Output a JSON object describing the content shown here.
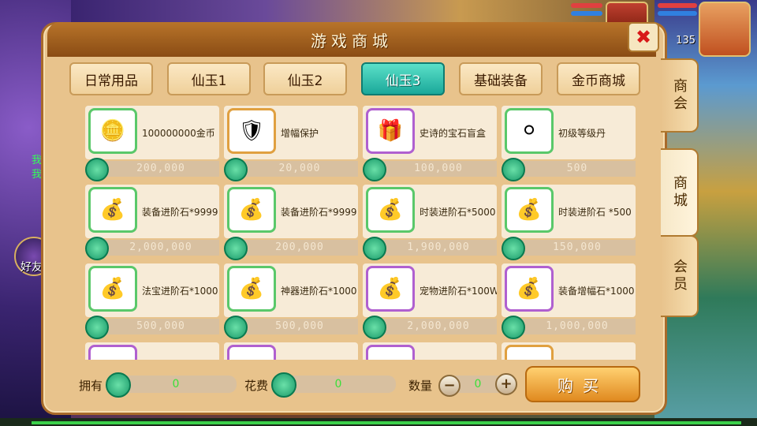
{
  "hud": {
    "level": "135"
  },
  "side": {
    "text1": "我爆",
    "text2": "我爆",
    "friend_label": "好友"
  },
  "dialog": {
    "title": "游戏商城"
  },
  "tabs": [
    {
      "label": "日常用品",
      "active": false
    },
    {
      "label": "仙玉1",
      "active": false
    },
    {
      "label": "仙玉2",
      "active": false
    },
    {
      "label": "仙玉3",
      "active": true
    },
    {
      "label": "基础装备",
      "active": false
    },
    {
      "label": "金币商城",
      "active": false
    }
  ],
  "side_tabs": [
    {
      "label": "商会",
      "active": false
    },
    {
      "label": "商城",
      "active": true
    },
    {
      "label": "会员",
      "active": false
    }
  ],
  "items": [
    {
      "name": "100000000金币",
      "price": "200,000",
      "icon": "gold-coin-icon",
      "frame": "green"
    },
    {
      "name": "增幅保护",
      "price": "20,000",
      "icon": "protect-shield-icon",
      "frame": "orange"
    },
    {
      "name": "史诗的宝石盲盒",
      "price": "100,000",
      "icon": "treasure-chest-icon",
      "frame": "purple"
    },
    {
      "name": "初级等级丹",
      "price": "500",
      "icon": "pill-icon",
      "frame": "green"
    },
    {
      "name": "装备进阶石*9999",
      "price": "2,000,000",
      "icon": "stone-bag-icon",
      "frame": "green"
    },
    {
      "name": "装备进阶石*9999",
      "price": "200,000",
      "icon": "stone-bag-icon",
      "frame": "green"
    },
    {
      "name": "时装进阶石*5000",
      "price": "1,900,000",
      "icon": "stone-bag-icon",
      "frame": "green"
    },
    {
      "name": "时装进阶石 *500",
      "price": "150,000",
      "icon": "stone-bag-icon",
      "frame": "green"
    },
    {
      "name": "法宝进阶石*1000",
      "price": "500,000",
      "icon": "stone-bag-icon",
      "frame": "green"
    },
    {
      "name": "神器进阶石*1000",
      "price": "500,000",
      "icon": "stone-bag-icon",
      "frame": "green"
    },
    {
      "name": "宠物进阶石*100W",
      "price": "2,000,000",
      "icon": "stone-bag-icon",
      "frame": "purple"
    },
    {
      "name": "装备增幅石*1000",
      "price": "1,000,000",
      "icon": "stone-bag-icon",
      "frame": "purple"
    },
    {
      "name": "",
      "price": "",
      "icon": "item-icon",
      "frame": "purple"
    },
    {
      "name": "",
      "price": "",
      "icon": "item-icon",
      "frame": "purple"
    },
    {
      "name": "",
      "price": "",
      "icon": "item-icon",
      "frame": "purple"
    },
    {
      "name": "",
      "price": "",
      "icon": "item-icon",
      "frame": "orange"
    }
  ],
  "bottom": {
    "own_label": "拥有",
    "own_value": "0",
    "cost_label": "花费",
    "cost_value": "0",
    "qty_label": "数量",
    "qty_value": "0",
    "minus": "−",
    "plus": "+",
    "buy_label": "购买"
  },
  "icons": {
    "close": "close-icon",
    "currency": "jade-coin-icon"
  }
}
